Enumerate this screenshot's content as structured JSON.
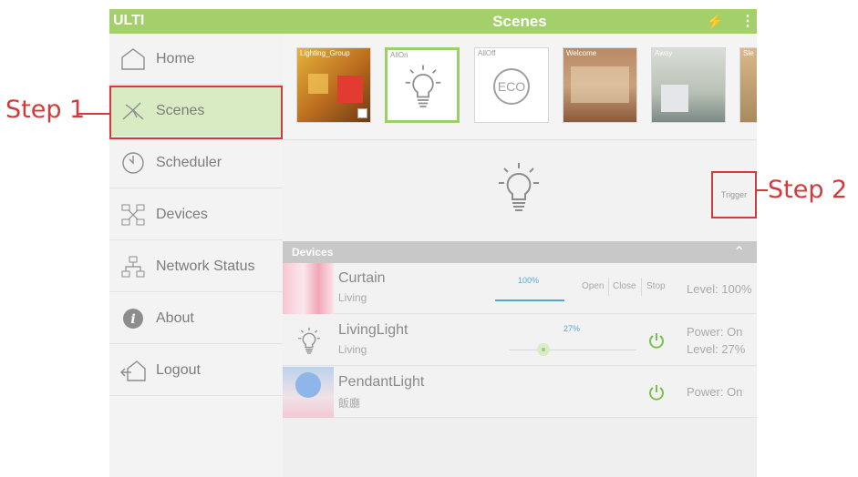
{
  "annotations": {
    "step1": "Step 1",
    "step2": "Step 2"
  },
  "app": {
    "brand": "ULTI",
    "title": "Scenes",
    "accent_color": "#a3d06a",
    "annotation_color": "#d33a3a"
  },
  "sidebar": {
    "items": [
      {
        "label": "Home",
        "icon": "home-icon"
      },
      {
        "label": "Scenes",
        "icon": "scenes-icon",
        "active": true
      },
      {
        "label": "Scheduler",
        "icon": "clock-icon"
      },
      {
        "label": "Devices",
        "icon": "devices-icon"
      },
      {
        "label": "Network Status",
        "icon": "network-icon"
      },
      {
        "label": "About",
        "icon": "info-icon"
      },
      {
        "label": "Logout",
        "icon": "logout-icon"
      }
    ]
  },
  "scenes": [
    {
      "label": "Lighting_Group",
      "type": "photo"
    },
    {
      "label": "AllOn",
      "type": "bulb",
      "selected": true
    },
    {
      "label": "AllOff",
      "type": "eco",
      "icon_text": "ECO"
    },
    {
      "label": "Welcome",
      "type": "photo"
    },
    {
      "label": "Away",
      "type": "photo"
    },
    {
      "label": "Sle",
      "type": "photo"
    }
  ],
  "trigger": {
    "label": "Trigger"
  },
  "devices_section": {
    "title": "Devices"
  },
  "devices": [
    {
      "name": "Curtain",
      "room": "Living",
      "percent": "100%",
      "controls": [
        "Open",
        "Close",
        "Stop"
      ],
      "status": "Level: 100%"
    },
    {
      "name": "LivingLight",
      "room": "Living",
      "percent": "27%",
      "level_fraction": 0.27,
      "status_line1": "Power: On",
      "status_line2": "Level: 27%"
    },
    {
      "name": "PendantLight",
      "room": "飯廳",
      "status": "Power: On"
    }
  ]
}
